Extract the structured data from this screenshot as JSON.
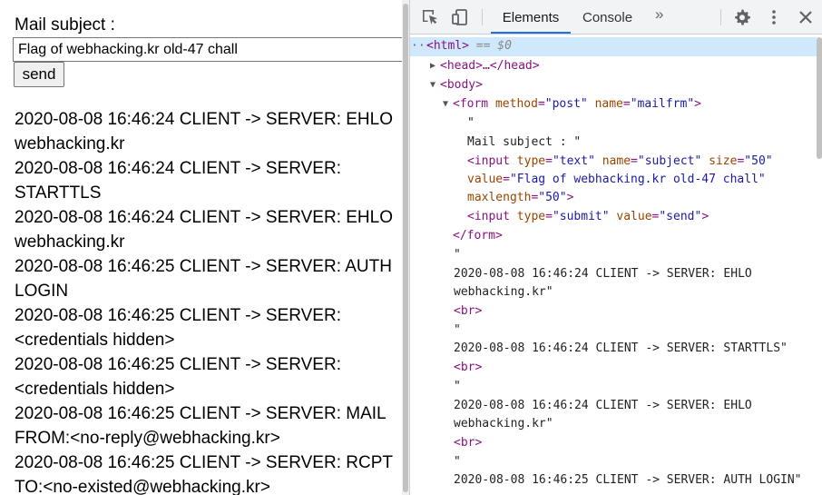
{
  "page": {
    "subject_label": "Mail subject :",
    "subject_value": "Flag of webhacking.kr old-47 chall",
    "send_label": "send",
    "log_lines": [
      "2020-08-08 16:46:24 CLIENT -> SERVER: EHLO",
      "webhacking.kr",
      "2020-08-08 16:46:24 CLIENT -> SERVER:",
      "STARTTLS",
      "2020-08-08 16:46:24 CLIENT -> SERVER: EHLO",
      "webhacking.kr",
      "2020-08-08 16:46:25 CLIENT -> SERVER: AUTH",
      "LOGIN",
      "2020-08-08 16:46:25 CLIENT -> SERVER:",
      "<credentials hidden>",
      "2020-08-08 16:46:25 CLIENT -> SERVER:",
      "<credentials hidden>",
      "2020-08-08 16:46:25 CLIENT -> SERVER: MAIL",
      "FROM:<no-reply@webhacking.kr>",
      "2020-08-08 16:46:25 CLIENT -> SERVER: RCPT",
      "TO:<no-existed@webhacking.kr>"
    ]
  },
  "devtools": {
    "tabs": [
      "Elements",
      "Console"
    ],
    "more_tabs": "»",
    "icons": [
      "inspect-element-icon",
      "device-toggle-icon",
      "settings-gear-icon",
      "kebab-menu-icon",
      "close-icon"
    ],
    "tree": {
      "ellipsis": "···",
      "html_open": "<html>",
      "selected_marker": "== $0",
      "head": "<head>…</head>",
      "body_open": "<body>",
      "form_tag": "form",
      "form_method_attr": "method",
      "form_method_val": "\"post\"",
      "form_name_attr": "name",
      "form_name_val": "\"mailfrm\"",
      "quote": "\"",
      "mail_subject_text": "Mail subject : \"",
      "input1_tag": "input",
      "input1_type_attr": "type",
      "input1_type_val": "\"text\"",
      "input1_name_attr": "name",
      "input1_name_val": "\"subject\"",
      "input1_size_attr": "size",
      "input1_size_val": "\"50\"",
      "input1_value_attr": "value",
      "input1_value_val": "\"Flag of webhacking.kr old-47 chall\"",
      "input1_maxlength_attr": "maxlength",
      "input1_maxlength_val": "\"50\"",
      "input2_tag": "input",
      "input2_type_attr": "type",
      "input2_type_val": "\"submit\"",
      "input2_value_attr": "value",
      "input2_value_val": "\"send\"",
      "form_close": "</form>",
      "br": "<br>",
      "text_ehlo1_a": "2020-08-08 16:46:24 CLIENT -> SERVER: EHLO",
      "text_ehlo1_b": "webhacking.kr\"",
      "text_starttls": "2020-08-08 16:46:24 CLIENT -> SERVER: STARTTLS\"",
      "text_ehlo2_a": "2020-08-08 16:46:24 CLIENT -> SERVER: EHLO",
      "text_ehlo2_b": "webhacking.kr\"",
      "text_auth": "2020-08-08 16:46:25 CLIENT -> SERVER: AUTH LOGIN\""
    }
  }
}
